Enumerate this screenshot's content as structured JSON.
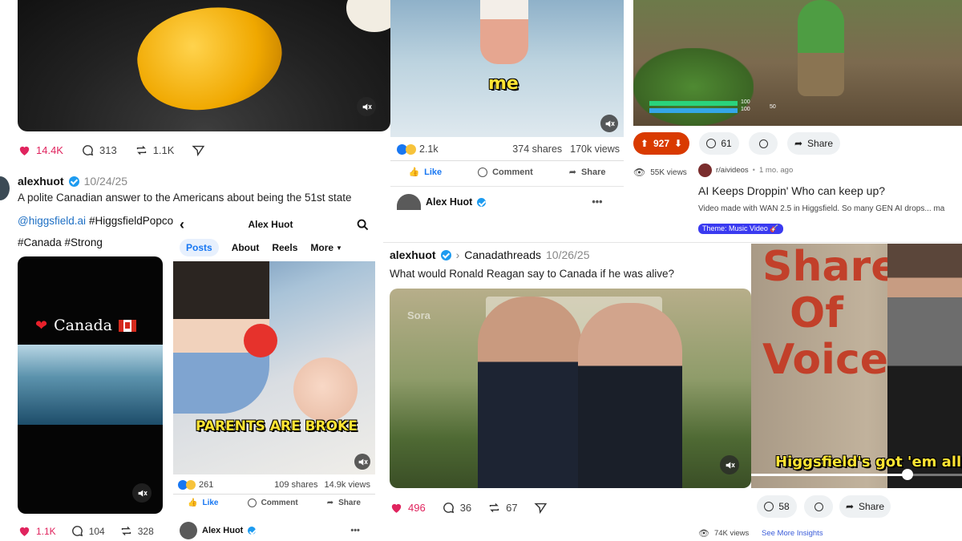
{
  "post_threads_top": {
    "likes": "14.4K",
    "comments": "313",
    "reposts": "1.1K"
  },
  "post_threads_canada": {
    "username": "alexhuot",
    "date": "10/24/25",
    "text": "A polite Canadian answer to the Americans about being the 51st state",
    "mention": "@higgsfield.ai",
    "tag1": "#HiggsfieldPopcorn",
    "tags2": "#Canada #Strong",
    "video_title": "Canada",
    "likes": "1.1K",
    "comments": "104",
    "reposts": "328"
  },
  "fb_top": {
    "caption": "me",
    "reactions": "2.1k",
    "shares": "374 shares",
    "views": "170k views",
    "like": "Like",
    "comment": "Comment",
    "share": "Share",
    "author": "Alex Huot"
  },
  "fb_profile": {
    "page_name": "Alex Huot",
    "tabs": [
      "Posts",
      "About",
      "Reels",
      "More"
    ],
    "video_caption": "PARENTS ARE BROKE",
    "reactions": "261",
    "shares": "109 shares",
    "views": "14.9k views",
    "like": "Like",
    "comment": "Comment",
    "share": "Share",
    "author": "Alex Huot"
  },
  "reddit": {
    "votes": "927",
    "comments": "61",
    "share": "Share",
    "views": "55K views",
    "subreddit": "r/aivideos",
    "age": "1 mo. ago",
    "title": "AI Keeps Droppin' Who can keep up?",
    "body": "Video made with WAN 2.5 in Higgsfield. So many GEN AI drops... ma",
    "flair": "Theme: Music Video 🎸",
    "hud1": "100",
    "hud2": "100",
    "hud3": "50"
  },
  "post_threads_reagan": {
    "username": "alexhuot",
    "channel": "Canadathreads",
    "date": "10/26/25",
    "text": "What would Ronald Reagan say to Canada if he was alive?",
    "watermark": "Sora",
    "likes": "496",
    "comments": "36",
    "reposts": "67"
  },
  "reel_right": {
    "wall_text": [
      "Share",
      "Of",
      "Voice"
    ],
    "caption": "Higgsfield's got 'em all,",
    "comments": "58",
    "share": "Share",
    "views": "74K views",
    "insights": "See More Insights"
  },
  "colors": {
    "like_red": "#e0245e",
    "fb_blue": "#1877f2",
    "reddit_orange": "#ff4500",
    "flair_blue": "#3a3af0"
  }
}
